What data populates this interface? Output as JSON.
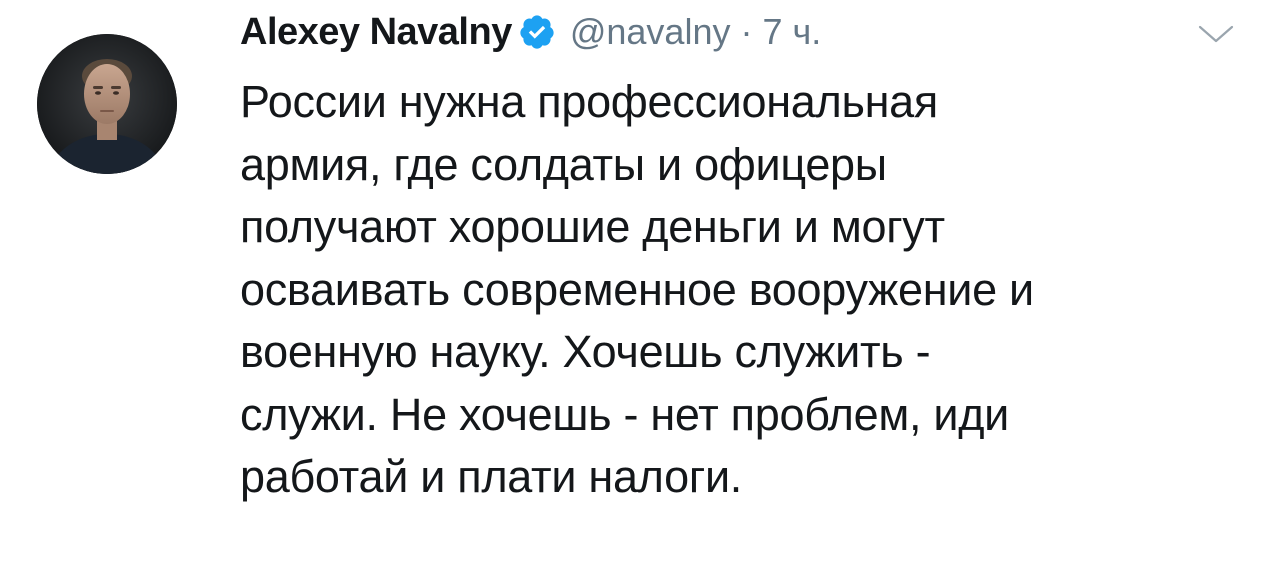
{
  "tweet": {
    "author_name": "Alexey Navalny",
    "handle": "@navalny",
    "separator": "·",
    "time": "7 ч.",
    "verified": true,
    "lines": [
      "России нужна профессиональная",
      "армия, где солдаты и офицеры",
      "получают хорошие деньги и могут",
      "осваивать современное вооружение и",
      "военную науку. Хочешь служить -",
      "служи. Не хочешь - нет проблем, иди",
      "работай и плати налоги."
    ]
  },
  "icons": {
    "verified": "verified-badge-icon",
    "caret": "chevron-down-icon"
  },
  "colors": {
    "text": "#14171a",
    "secondary": "#657786",
    "verified": "#1da1f2"
  }
}
